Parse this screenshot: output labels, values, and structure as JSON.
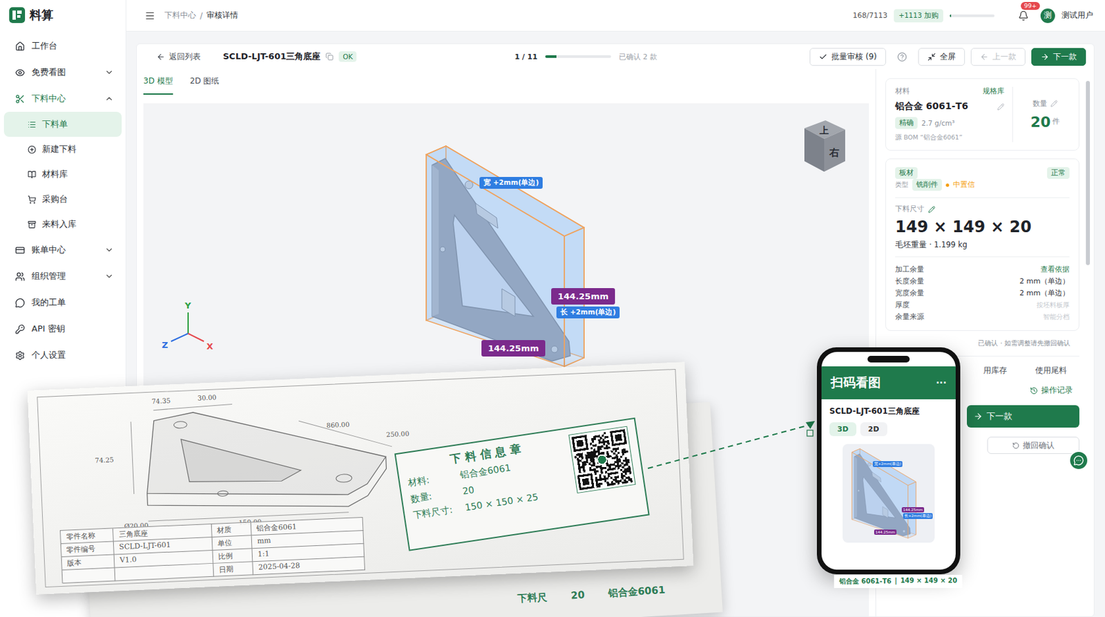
{
  "app": {
    "name": "料算"
  },
  "sidebar": {
    "items": [
      {
        "label": "工作台",
        "expandable": false,
        "expanded": false,
        "children": []
      },
      {
        "label": "免费看图",
        "expandable": true,
        "expanded": false,
        "children": []
      },
      {
        "label": "下料中心",
        "expandable": true,
        "expanded": true,
        "children": [
          {
            "label": "下料单",
            "selected": true
          },
          {
            "label": "新建下料",
            "selected": false
          },
          {
            "label": "材料库",
            "selected": false
          },
          {
            "label": "采购台",
            "selected": false
          },
          {
            "label": "来料入库",
            "selected": false
          }
        ]
      },
      {
        "label": "账单中心",
        "expandable": true,
        "expanded": false,
        "children": []
      },
      {
        "label": "组织管理",
        "expandable": true,
        "expanded": false,
        "children": []
      },
      {
        "label": "我的工单",
        "expandable": false,
        "expanded": false,
        "children": []
      },
      {
        "label": "API 密钥",
        "expandable": false,
        "expanded": false,
        "children": []
      },
      {
        "label": "个人设置",
        "expandable": false,
        "expanded": false,
        "children": []
      }
    ]
  },
  "topbar": {
    "breadcrumb": [
      "下料中心",
      "审核详情"
    ],
    "separator": "/",
    "quota": "168/7113",
    "topup": "+1113 加购",
    "quota_level": 0.03,
    "badge": "99+",
    "avatar": "测",
    "user": "测试用户"
  },
  "header": {
    "back": "返回列表",
    "title": "SCLD-LJT-601三角底座",
    "status": "OK",
    "pager": "1 / 11",
    "pager_level": 0.17,
    "confirmed": "已确认 2 款",
    "buttons": [
      {
        "label": "批量审核 (9)",
        "kind": "outline",
        "disabled": false
      },
      {
        "label": "全屏",
        "kind": "outline",
        "disabled": false
      },
      {
        "label": "上一款",
        "kind": "outline",
        "disabled": true
      },
      {
        "label": "下一款",
        "kind": "primary",
        "disabled": false
      }
    ]
  },
  "viewer": {
    "tabs": [
      {
        "label": "3D 模型",
        "selected": true
      },
      {
        "label": "2D 图纸",
        "selected": false
      }
    ],
    "cube": [
      "上",
      "右"
    ],
    "axes": [
      "Y",
      "Z",
      "X"
    ],
    "labels": [
      {
        "text": "宽 +2mm(单边)",
        "kind": "allowance"
      },
      {
        "text": "144.25mm",
        "kind": "dimension"
      },
      {
        "text": "长 +2mm(单边)",
        "kind": "allowance"
      },
      {
        "text": "144.25mm",
        "kind": "dimension"
      }
    ]
  },
  "material": {
    "label": "材料",
    "link": "规格库",
    "name": "铝合金 6061-T6",
    "tag": "精确",
    "density": "2.7 g/cm³",
    "source": "源 BOM “铝合金6061”",
    "qty_label": "数量",
    "qty": "20",
    "qty_unit": "件"
  },
  "stock": {
    "tag": "板材",
    "status": "正常",
    "type_label": "类型",
    "type": "铣削件",
    "confidence": "中置信",
    "confidence_color": "#f59e0b",
    "size_label": "下料尺寸",
    "size": "149 × 149 × 20",
    "weight": "毛坯重量 · 1.199 kg",
    "allowance_title": "加工余量",
    "allowance_link": "查看依据",
    "rows": [
      {
        "label": "长度余量",
        "value": "2 mm（单边）",
        "muted": false
      },
      {
        "label": "宽度余量",
        "value": "2 mm（单边）",
        "muted": false
      },
      {
        "label": "厚度",
        "value": "按坯料板厚",
        "muted": true
      },
      {
        "label": "余量来源",
        "value": "智能分档",
        "muted": true
      }
    ]
  },
  "note": "已确认 · 如需调整请先撤回确认",
  "lower": {
    "options": [
      {
        "label": "用库存",
        "selected": false
      },
      {
        "label": "使用尾料",
        "selected": false
      }
    ],
    "log": "操作记录",
    "next": "下一款",
    "revoke": "撤回确认"
  },
  "paper": {
    "dims": [
      "74.35",
      "30.00",
      "860.00",
      "250.00",
      "74.25",
      "Ø20.00",
      "150.00"
    ],
    "title_block": [
      {
        "label": "零件名称",
        "value": "三角底座",
        "label2": "材质",
        "value2": "铝合金6061"
      },
      {
        "label": "零件编号",
        "value": "SCLD-LJT-601",
        "label2": "单位",
        "value2": "mm"
      },
      {
        "label": "版本",
        "value": "V1.0",
        "label2": "比例",
        "value2": "1:1"
      },
      {
        "label2": "日期",
        "value2": "2025-04-28"
      }
    ],
    "stamp": {
      "title": "下料信息章",
      "rows": [
        {
          "label": "材料:",
          "value": "铝合金6061"
        },
        {
          "label": "数量:",
          "value": "20"
        },
        {
          "label": "下料尺寸:",
          "value": "150 × 150 × 25"
        }
      ]
    },
    "under_sheet": [
      "下料尺",
      "20",
      "铝合金6061"
    ]
  },
  "phone": {
    "title": "扫码看图",
    "menu": "···",
    "part": "SCLD-LJT-601三角底座",
    "tabs": [
      {
        "label": "3D",
        "selected": true
      },
      {
        "label": "2D",
        "selected": false
      }
    ],
    "labels": [
      "宽+2mm(单边)",
      "144.25mm",
      "长+2mm(单边)",
      "144.25mm"
    ],
    "footer": [
      "铝合金 6061-T6",
      "|",
      "149 × 149 × 20"
    ]
  }
}
